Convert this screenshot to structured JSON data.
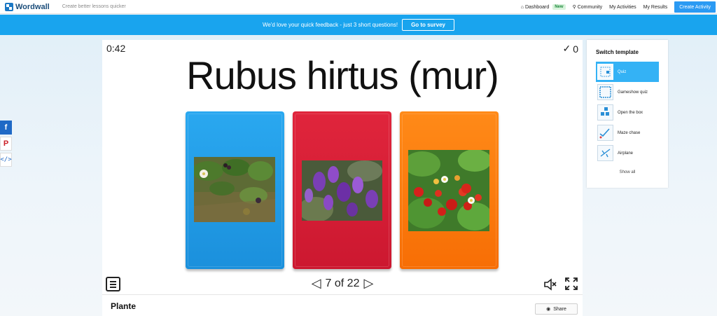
{
  "topbar": {
    "logo": "Wordwall",
    "tagline": "Create better lessons quicker",
    "nav": {
      "dashboard": "Dashboard",
      "badge": "New",
      "community": "Community",
      "my_activities": "My Activities",
      "my_results": "My Results",
      "create": "Create Activity"
    }
  },
  "banner": {
    "text": "We'd love your quick feedback - just 3 short questions!",
    "button": "Go to survey"
  },
  "activity": {
    "timer": "0:42",
    "score": "0",
    "question": "Rubus hirtus (mur)",
    "answers": [
      {
        "color": "#1f9ae6",
        "image": "bramble-plant-photo"
      },
      {
        "color": "#d71f36",
        "image": "purple-vetch-flowers-photo"
      },
      {
        "color": "#fb7c0e",
        "image": "wild-strawberries-photo"
      }
    ],
    "pager": "7 of 22",
    "title": "Plante",
    "share": "Share"
  },
  "switch_template": {
    "title": "Switch template",
    "items": [
      {
        "label": "Quiz",
        "active": true
      },
      {
        "label": "Gameshow quiz",
        "active": false
      },
      {
        "label": "Open the box",
        "active": false
      },
      {
        "label": "Maze chase",
        "active": false
      },
      {
        "label": "Airplane",
        "active": false
      }
    ],
    "show_all": "Show all"
  },
  "social": {
    "facebook": "f",
    "pinterest": "P",
    "embed": "</>"
  },
  "colors": {
    "accent": "#2b9af3",
    "banner": "#19a4ee"
  }
}
